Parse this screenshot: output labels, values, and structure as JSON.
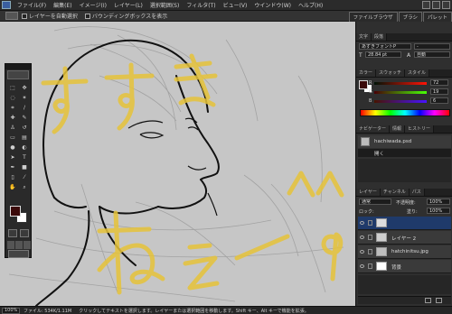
{
  "menu": [
    "ファイル(F)",
    "編集(E)",
    "イメージ(I)",
    "レイヤー(L)",
    "選択範囲(S)",
    "フィルタ(T)",
    "ビュー(V)",
    "ウインドウ(W)",
    "ヘルプ(H)"
  ],
  "options": {
    "auto_select": "レイヤーを自動選択",
    "bounding_box": "バウンディングボックスを表示",
    "tabs": [
      "ファイルブラウザ",
      "ブラシ",
      "パレット"
    ]
  },
  "canvas": {
    "handwriting": [
      "すすき",
      "ねぇーっ^ ^9"
    ],
    "handwriting_color": "#e6c33a",
    "background": "#c6c6c6"
  },
  "character_panel": {
    "tabs": [
      "文字",
      "段落"
    ],
    "font": "あずきフォントP",
    "style": "-",
    "size": "28.84 pt",
    "leading": "自動"
  },
  "color_panel": {
    "tabs": [
      "カラー",
      "スウォッチ",
      "スタイル"
    ],
    "r_label": "R",
    "g_label": "G",
    "b_label": "B",
    "r": "72",
    "g": "19",
    "b": "6"
  },
  "history_panel": {
    "tabs": [
      "ナビゲーター",
      "情報",
      "ヒストリー"
    ],
    "document": "hachiwada.psd",
    "state": "開く"
  },
  "layers_panel": {
    "tabs": [
      "レイヤー",
      "チャンネル",
      "パス"
    ],
    "blend_mode": "通常",
    "opacity_label": "不透明度:",
    "opacity": "100%",
    "lock_label": "ロック:",
    "fill_label": "塗り:",
    "fill": "100%",
    "layers": [
      {
        "name": "",
        "type": "text"
      },
      {
        "name": "レイヤー 2",
        "type": "layer"
      },
      {
        "name": "hatchinitsu.jpg",
        "type": "image"
      },
      {
        "name": "背景",
        "type": "background"
      }
    ]
  },
  "status": {
    "zoom": "100%",
    "doc_info": "ファイル: 534K/1.11M",
    "hint": "クリックしてテキストを選択します。レイヤーまたは選択範囲を移動します。Shift キー、Alt キーで機能を拡張。"
  },
  "colors": {
    "accent": "#e6c33a",
    "foreground_swatch": "#3b0a0a",
    "background_swatch": "#ffffff"
  }
}
